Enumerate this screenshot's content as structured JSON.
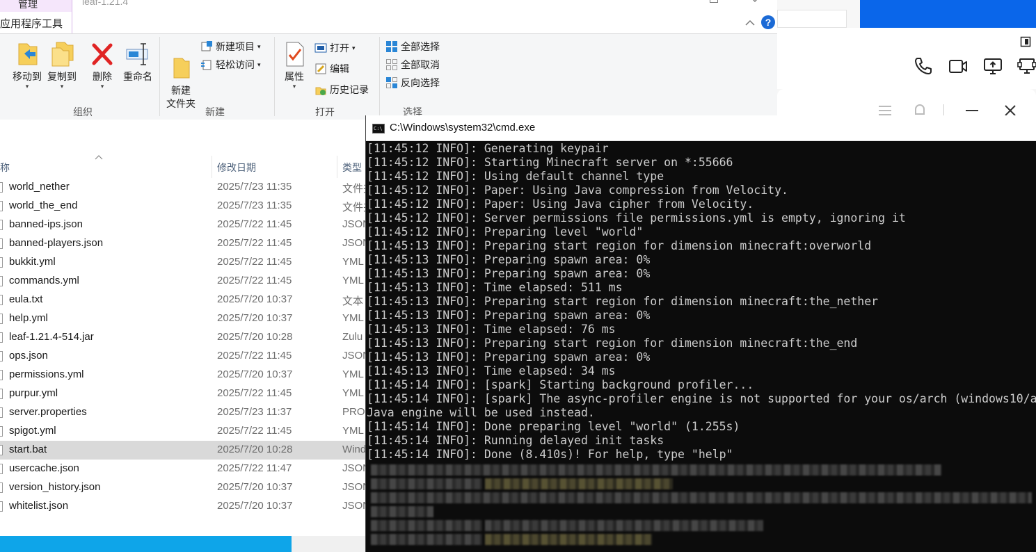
{
  "explorer": {
    "manage_tab": "管理",
    "title": "leaf-1.21.4",
    "app_tools_tab": "应用程序工具",
    "ribbon": {
      "move_to": "移动到",
      "copy_to": "复制到",
      "delete": "删除",
      "rename": "重命名",
      "new_folder": "新建\n文件夹",
      "new_item": "新建项目",
      "easy_access": "轻松访问",
      "properties": "属性",
      "open": "打开",
      "edit": "编辑",
      "history": "历史记录",
      "select_all": "全部选择",
      "select_none": "全部取消",
      "invert_selection": "反向选择",
      "group_organize": "组织",
      "group_new": "新建",
      "group_open": "打开",
      "group_select": "选择"
    },
    "columns": {
      "name": "称",
      "date": "修改日期",
      "type": "类型"
    },
    "files": [
      {
        "name": "world_nether",
        "date": "2025/7/23 11:35",
        "type": "文件夹"
      },
      {
        "name": "world_the_end",
        "date": "2025/7/23 11:35",
        "type": "文件夹"
      },
      {
        "name": "banned-ips.json",
        "date": "2025/7/22 11:45",
        "type": "JSON"
      },
      {
        "name": "banned-players.json",
        "date": "2025/7/22 11:45",
        "type": "JSON"
      },
      {
        "name": "bukkit.yml",
        "date": "2025/7/22 11:45",
        "type": "YML"
      },
      {
        "name": "commands.yml",
        "date": "2025/7/22 11:45",
        "type": "YML"
      },
      {
        "name": "eula.txt",
        "date": "2025/7/20 10:37",
        "type": "文本"
      },
      {
        "name": "help.yml",
        "date": "2025/7/20 10:37",
        "type": "YML"
      },
      {
        "name": "leaf-1.21.4-514.jar",
        "date": "2025/7/20 10:28",
        "type": "Zulu"
      },
      {
        "name": "ops.json",
        "date": "2025/7/22 11:45",
        "type": "JSON"
      },
      {
        "name": "permissions.yml",
        "date": "2025/7/20 10:37",
        "type": "YML"
      },
      {
        "name": "purpur.yml",
        "date": "2025/7/22 11:45",
        "type": "YML"
      },
      {
        "name": "server.properties",
        "date": "2025/7/23 11:37",
        "type": "PRO"
      },
      {
        "name": "spigot.yml",
        "date": "2025/7/22 11:45",
        "type": "YML"
      },
      {
        "name": "start.bat",
        "date": "2025/7/20 10:28",
        "type": "Wind",
        "selected": true
      },
      {
        "name": "usercache.json",
        "date": "2025/7/22 11:47",
        "type": "JSON"
      },
      {
        "name": "version_history.json",
        "date": "2025/7/20 10:37",
        "type": "JSON"
      },
      {
        "name": "whitelist.json",
        "date": "2025/7/20 10:37",
        "type": "JSON"
      }
    ]
  },
  "cmd": {
    "title": "C:\\Windows\\system32\\cmd.exe",
    "lines": [
      "[11:45:12 INFO]: Generating keypair",
      "[11:45:12 INFO]: Starting Minecraft server on *:55666",
      "[11:45:12 INFO]: Using default channel type",
      "[11:45:12 INFO]: Paper: Using Java compression from Velocity.",
      "[11:45:12 INFO]: Paper: Using Java cipher from Velocity.",
      "[11:45:12 INFO]: Server permissions file permissions.yml is empty, ignoring it",
      "[11:45:12 INFO]: Preparing level \"world\"",
      "[11:45:13 INFO]: Preparing start region for dimension minecraft:overworld",
      "[11:45:13 INFO]: Preparing spawn area: 0%",
      "[11:45:13 INFO]: Preparing spawn area: 0%",
      "[11:45:13 INFO]: Time elapsed: 511 ms",
      "[11:45:13 INFO]: Preparing start region for dimension minecraft:the_nether",
      "[11:45:13 INFO]: Preparing spawn area: 0%",
      "[11:45:13 INFO]: Time elapsed: 76 ms",
      "[11:45:13 INFO]: Preparing start region for dimension minecraft:the_end",
      "[11:45:13 INFO]: Preparing spawn area: 0%",
      "[11:45:13 INFO]: Time elapsed: 34 ms",
      "[11:45:14 INFO]: [spark] Starting background profiler...",
      "[11:45:14 INFO]: [spark] The async-profiler engine is not supported for your os/arch (windows10/a",
      "Java engine will be used instead.",
      "[11:45:14 INFO]: Done preparing level \"world\" (1.255s)",
      "[11:45:14 INFO]: Running delayed init tasks",
      "[11:45:14 INFO]: Done (8.410s)! For help, type \"help\""
    ]
  },
  "colors": {
    "accent_blue": "#0a66ea",
    "status_blue": "#0ea5e9",
    "console_bg": "#0c0c0c",
    "console_text": "#cccccc",
    "selected_row": "#d9d9d9",
    "manage_tab": "#f5e6fb"
  }
}
